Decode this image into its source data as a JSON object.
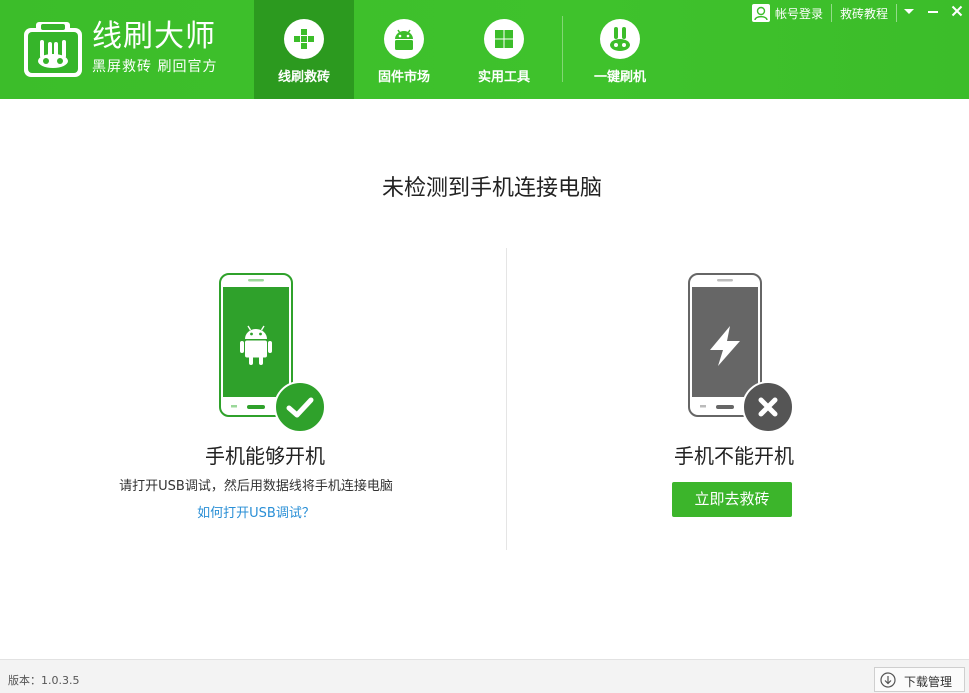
{
  "header": {
    "brand_name": "线刷大师",
    "brand_slogan": "黑屏救砖 刷回官方",
    "tabs": [
      {
        "label": "线刷救砖",
        "icon": "plus-cross-icon",
        "active": true
      },
      {
        "label": "固件市场",
        "icon": "android-icon",
        "active": false
      },
      {
        "label": "实用工具",
        "icon": "grid-icon",
        "active": false
      },
      {
        "label": "一键刷机",
        "icon": "rabbit-icon",
        "active": false
      }
    ],
    "login_label": "帐号登录",
    "tutorial_label": "救砖教程"
  },
  "main": {
    "title": "未检测到手机连接电脑",
    "left": {
      "title": "手机能够开机",
      "desc": "请打开USB调试，然后用数据线将手机连接电脑",
      "link": "如何打开USB调试？"
    },
    "right": {
      "title": "手机不能开机",
      "button": "立即去救砖"
    }
  },
  "footer": {
    "version": "版本：1.0.3.5",
    "download_label": "下载管理"
  },
  "colors": {
    "brand_green": "#3cbd2a",
    "active_tab": "#2c9a1f",
    "phone_green": "#2fa12b",
    "phone_gray": "#666666",
    "link_blue": "#2a8fd6"
  }
}
